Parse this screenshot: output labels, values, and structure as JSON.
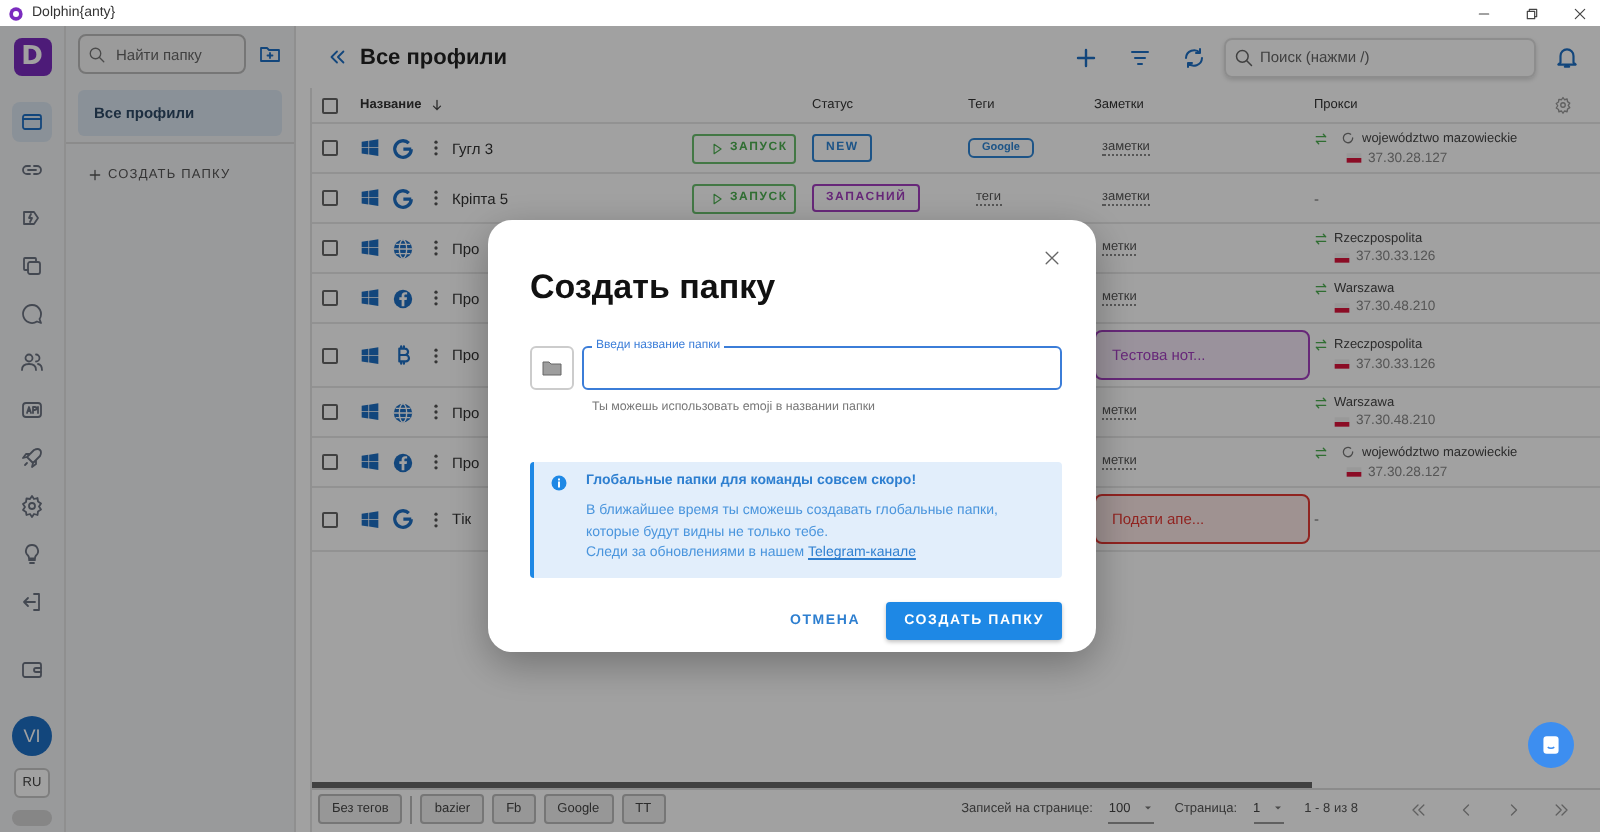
{
  "window": {
    "title": "Dolphin{anty}"
  },
  "rail": {
    "logo": "D",
    "items": [
      {
        "kind": "browser",
        "selected": true
      },
      {
        "kind": "link",
        "selected": false
      },
      {
        "kind": "tags",
        "selected": false
      },
      {
        "kind": "copy",
        "selected": false
      },
      {
        "kind": "chat",
        "selected": false
      },
      {
        "kind": "users",
        "selected": false
      },
      {
        "kind": "api",
        "selected": false
      },
      {
        "kind": "rocket",
        "selected": false
      },
      {
        "kind": "settings",
        "selected": false
      },
      {
        "kind": "ideas",
        "selected": false
      },
      {
        "kind": "logout",
        "selected": false
      },
      {
        "kind": "wallet",
        "selected": false
      }
    ],
    "avatar": "VI",
    "language": "RU",
    "dark_theme": false
  },
  "folders": {
    "search": {
      "placeholder": "Найти папку"
    },
    "items": [
      {
        "label": "Все профили",
        "selected": true
      }
    ],
    "create_label": "СОЗДАТЬ ПАПКУ"
  },
  "header": {
    "title": "Все профили",
    "search": {
      "placeholder": "Поиск (нажми /)"
    }
  },
  "table": {
    "select_all": {
      "checked": false
    },
    "columns": [
      "Название",
      "Статус",
      "Теги",
      "Заметки",
      "Прокси"
    ],
    "rows": [
      {
        "checked": false,
        "browser": {
          "kind": "google"
        },
        "name": "Гугл 3",
        "launch": "ЗАПУСК",
        "status": {
          "text": "NEW",
          "color": "#1d5487"
        },
        "tags": {
          "kind": "chip",
          "text": "Google"
        },
        "notes": {
          "kind": "plain",
          "text": "заметки"
        },
        "proxy": {
          "kind": "proxy",
          "checking": true,
          "name": "województwo mazowieckie",
          "ip": "37.30.28.127"
        }
      },
      {
        "checked": false,
        "browser": {
          "kind": "google"
        },
        "name": "Кріпта 5",
        "launch": "ЗАПУСК",
        "status": {
          "text": "ЗАПАСНИЙ",
          "color": "#672879"
        },
        "tags": {
          "kind": "empty",
          "text": "теги"
        },
        "notes": {
          "kind": "plain",
          "text": "заметки"
        },
        "proxy": {
          "kind": "none",
          "text": "-"
        }
      },
      {
        "checked": false,
        "browser": {
          "kind": "globe"
        },
        "name": "Про",
        "notes": {
          "kind": "plain",
          "text": "метки"
        },
        "proxy": {
          "kind": "proxy",
          "checking": false,
          "name": "Rzeczpospolita",
          "ip": "37.30.33.126"
        }
      },
      {
        "checked": false,
        "browser": {
          "kind": "facebook"
        },
        "name": "Про",
        "notes": {
          "kind": "plain",
          "text": "метки"
        },
        "proxy": {
          "kind": "proxy",
          "checking": false,
          "name": "Warszawa",
          "ip": "37.30.48.210"
        }
      },
      {
        "checked": false,
        "browser": {
          "kind": "bitcoin"
        },
        "name": "Про",
        "notes": {
          "kind": "chip",
          "text": "Тестова нот...",
          "color": "#672879"
        },
        "proxy": {
          "kind": "proxy",
          "checking": false,
          "name": "Rzeczpospolita",
          "ip": "37.30.33.126"
        }
      },
      {
        "checked": false,
        "browser": {
          "kind": "globe"
        },
        "name": "Про",
        "notes": {
          "kind": "plain",
          "text": "метки"
        },
        "proxy": {
          "kind": "proxy",
          "checking": false,
          "name": "Warszawa",
          "ip": "37.30.48.210"
        }
      },
      {
        "checked": false,
        "browser": {
          "kind": "facebook"
        },
        "name": "Про",
        "notes": {
          "kind": "plain",
          "text": "метки"
        },
        "proxy": {
          "kind": "proxy",
          "checking": true,
          "name": "województwo mazowieckie",
          "ip": "37.30.28.127"
        }
      },
      {
        "checked": false,
        "browser": {
          "kind": "google"
        },
        "name": "Тік",
        "notes": {
          "kind": "chip",
          "text": "Подати апе...",
          "color": "#902421"
        },
        "proxy": {
          "kind": "none",
          "text": "-"
        }
      }
    ]
  },
  "tag_filters": [
    "Без тегов",
    "bazier",
    "Fb",
    "Google",
    "TT"
  ],
  "pagination": {
    "per_page_label": "Записей на странице:",
    "per_page": "100",
    "page_label": "Страница:",
    "page": "1",
    "range": "1 - 8 из 8"
  },
  "modal": {
    "title": "Создать папку",
    "field": {
      "label": "Введи название папки"
    },
    "hint": "Ты можешь использовать emoji в названии папки",
    "info": {
      "title": "Глобальные папки для команды совсем скоро!",
      "text": "В ближайшее время ты сможешь создавать глобальные папки, которые будут видны не только тебе.",
      "follow": "Следи за обновлениями в нашем ",
      "link": "Telegram-канале"
    },
    "cancel": "ОТМЕНА",
    "confirm": "СОЗДАТЬ ПАПКУ"
  }
}
